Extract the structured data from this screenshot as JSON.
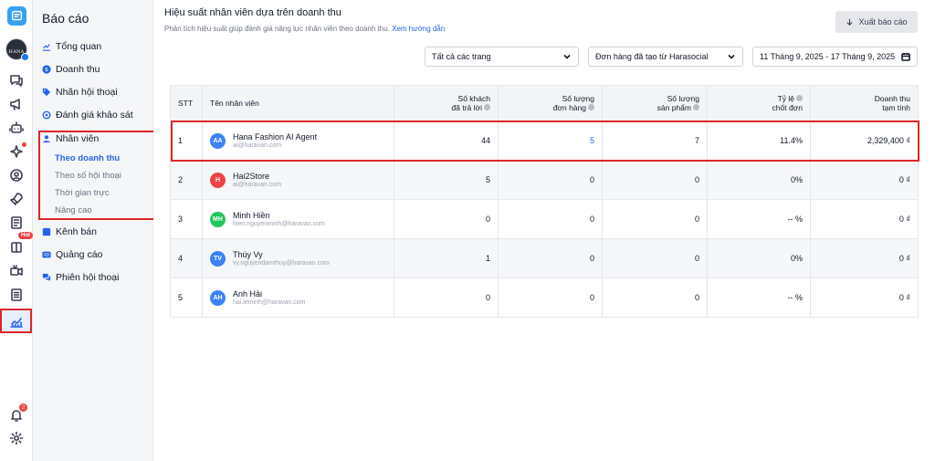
{
  "sidebar": {
    "title": "Báo cáo",
    "items": [
      {
        "label": "Tổng quan",
        "icon": "chart-line-icon"
      },
      {
        "label": "Doanh thu",
        "icon": "dollar-icon"
      },
      {
        "label": "Nhãn hội thoại",
        "icon": "tag-icon"
      },
      {
        "label": "Đánh giá khảo sát",
        "icon": "settings-gear-icon"
      },
      {
        "label": "Nhân viên",
        "icon": "user-icon"
      },
      {
        "label": "Kênh bán",
        "icon": "store-icon"
      },
      {
        "label": "Quảng cáo",
        "icon": "ad-icon"
      },
      {
        "label": "Phiên hội thoại",
        "icon": "chat-icon"
      }
    ],
    "sub_items": [
      {
        "label": "Theo doanh thu",
        "active": true
      },
      {
        "label": "Theo số hội thoại"
      },
      {
        "label": "Thời gian trực"
      },
      {
        "label": "Nâng cao"
      }
    ]
  },
  "rail": {
    "avatar_text": "HANA",
    "hot_badge": "Hot",
    "notification_count": "2"
  },
  "header": {
    "title": "Hiệu suất nhân viên dựa trên doanh thu",
    "subtitle": "Phân tích hiệu suất giúp đánh giá năng lực nhân viên theo doanh thu.",
    "guide_link": "Xem hướng dẫn",
    "export_label": "Xuất báo cáo"
  },
  "filters": {
    "pages": "Tất cả các trang",
    "orders": "Đơn hàng đã tạo từ Harasocial",
    "date_range": "11 Tháng 9, 2025 - 17 Tháng 9, 2025"
  },
  "table": {
    "headers": {
      "stt": "STT",
      "name": "Tên nhân viên",
      "customers_1": "Số khách",
      "customers_2": "đã trả lời",
      "orders_1": "Số lượng",
      "orders_2": "đơn hàng",
      "products_1": "Số lượng",
      "products_2": "sản phẩm",
      "rate_1": "Tỷ lệ",
      "rate_2": "chốt đơn",
      "revenue_1": "Doanh thu",
      "revenue_2": "tạm tính"
    },
    "rows": [
      {
        "stt": "1",
        "initials": "AA",
        "color": "#3b82f6",
        "name": "Hana Fashion AI Agent",
        "email": "ai@haravan.com",
        "customers": "44",
        "orders": "5",
        "products": "7",
        "rate": "11.4%",
        "revenue": "2,329,400 ₫"
      },
      {
        "stt": "2",
        "initials": "H",
        "color": "#ef4444",
        "name": "Hai2Store",
        "email": "ai@haravan.com",
        "customers": "5",
        "orders": "0",
        "products": "0",
        "rate": "0%",
        "revenue": "0 ₫"
      },
      {
        "stt": "3",
        "initials": "MH",
        "color": "#22c55e",
        "name": "Minh Hiền",
        "email": "hien.nguyenminh@haravan.com",
        "customers": "0",
        "orders": "0",
        "products": "0",
        "rate": "-- %",
        "revenue": "0 ₫"
      },
      {
        "stt": "4",
        "initials": "TV",
        "color": "#3b82f6",
        "name": "Thúy Vy",
        "email": "vy.nguyendamthuy@haravan.com",
        "customers": "1",
        "orders": "0",
        "products": "0",
        "rate": "0%",
        "revenue": "0 ₫"
      },
      {
        "stt": "5",
        "initials": "AH",
        "color": "#3b82f6",
        "name": "Anh Hải",
        "email": "hai.leminh@haravan.com",
        "customers": "0",
        "orders": "0",
        "products": "0",
        "rate": "-- %",
        "revenue": "0 ₫"
      }
    ]
  }
}
